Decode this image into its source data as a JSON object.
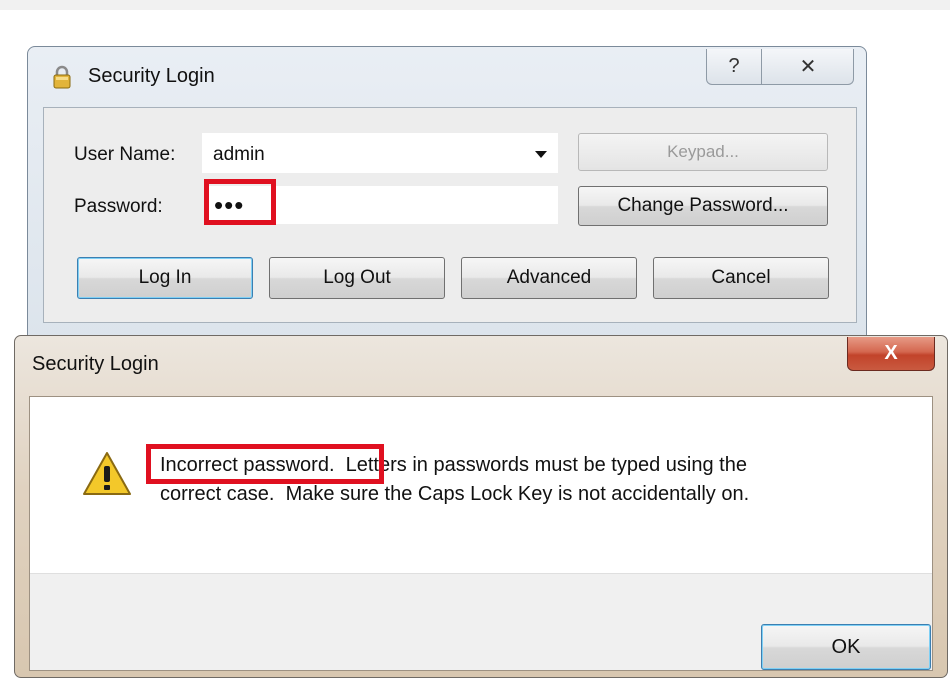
{
  "login_window": {
    "title": "Security Login",
    "title_icon": "lock-icon",
    "help_glyph": "?",
    "close_glyph": "✕",
    "user_label": "User Name:",
    "user_value": "admin",
    "password_label": "Password:",
    "password_mask": "•••",
    "keypad_label": "Keypad...",
    "change_password_label": "Change Password...",
    "login_label": "Log In",
    "logout_label": "Log Out",
    "advanced_label": "Advanced",
    "cancel_label": "Cancel"
  },
  "error_dialog": {
    "title": "Security Login",
    "close_glyph": "X",
    "icon": "warning-icon",
    "message_line1": "Incorrect password.  Letters in passwords must be typed using the",
    "message_line2": "correct case.  Make sure the Caps Lock Key is not accidentally on.",
    "ok_label": "OK"
  },
  "colors": {
    "highlight": "#e01020",
    "close_button": "#c9503a",
    "default_button_border": "#3c7fb1"
  }
}
